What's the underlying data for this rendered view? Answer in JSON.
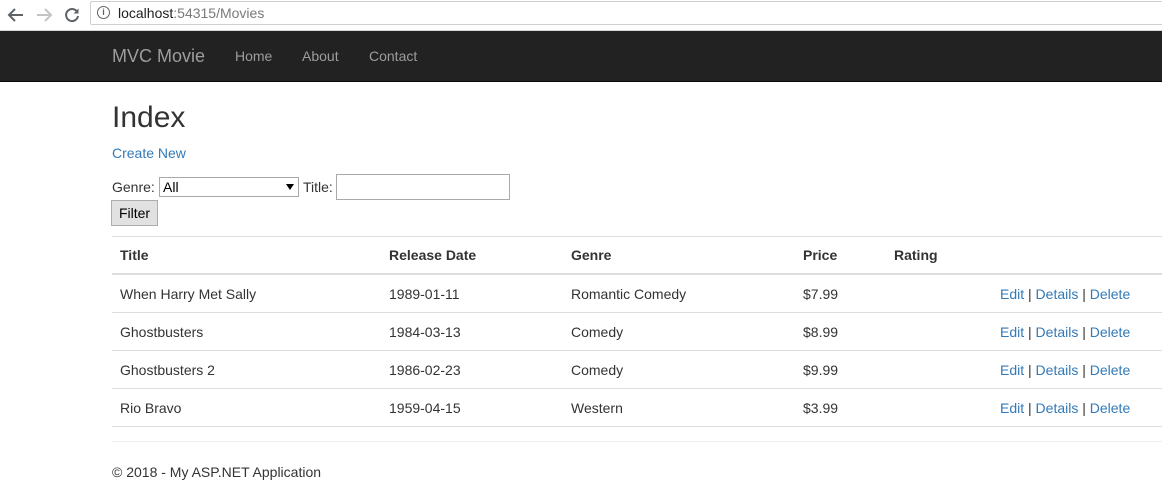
{
  "browser": {
    "url_host": "localhost",
    "url_rest": ":54315/Movies",
    "info_glyph": "i"
  },
  "navbar": {
    "brand": "MVC Movie",
    "links": [
      "Home",
      "About",
      "Contact"
    ]
  },
  "page": {
    "title": "Index",
    "create_link": "Create New"
  },
  "filter": {
    "genre_label": "Genre:",
    "genre_selected": "All",
    "title_label": "Title:",
    "title_value": "",
    "button_label": "Filter"
  },
  "table": {
    "headers": [
      "Title",
      "Release Date",
      "Genre",
      "Price",
      "Rating"
    ],
    "rows": [
      {
        "title": "When Harry Met Sally",
        "release_date": "1989-01-11",
        "genre": "Romantic Comedy",
        "price": "$7.99",
        "rating": ""
      },
      {
        "title": "Ghostbusters",
        "release_date": "1984-03-13",
        "genre": "Comedy",
        "price": "$8.99",
        "rating": ""
      },
      {
        "title": "Ghostbusters 2",
        "release_date": "1986-02-23",
        "genre": "Comedy",
        "price": "$9.99",
        "rating": ""
      },
      {
        "title": "Rio Bravo",
        "release_date": "1959-04-15",
        "genre": "Western",
        "price": "$3.99",
        "rating": ""
      }
    ],
    "actions": {
      "edit": "Edit",
      "details": "Details",
      "delete": "Delete",
      "separator": "|"
    }
  },
  "footer": {
    "text": "© 2018 - My ASP.NET Application"
  },
  "colors": {
    "navbar_bg": "#222222",
    "link": "#337ab7",
    "nav_text": "#9d9d9d"
  }
}
